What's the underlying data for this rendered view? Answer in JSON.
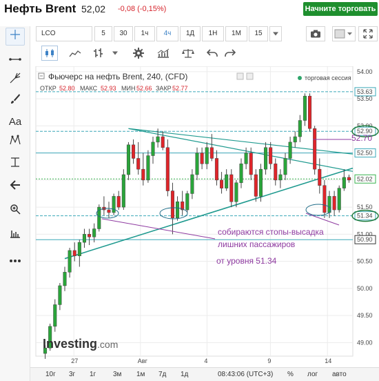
{
  "header": {
    "instrument": "Нефть Brent",
    "price": "52,02",
    "change": "-0,08 (-0,15%)",
    "trade_button": "Начните торговать"
  },
  "toolbar": {
    "symbol": "LCO",
    "intervals": [
      "5",
      "30",
      "1ч",
      "4ч",
      "1Д",
      "1Н",
      "1М",
      "15"
    ],
    "active_interval": "4ч"
  },
  "left_tools": [
    "crosshair-icon",
    "line-icon",
    "fork-icon",
    "brush-icon",
    "text-icon",
    "pattern-icon",
    "measure-icon",
    "back-arrow-icon",
    "zoom-icon",
    "ruler-icon",
    "more-icon"
  ],
  "left_text_tool": "Aa",
  "chart": {
    "title": "Фьючерс на нефть Brent, 240, (CFD)",
    "session": "торговая сессия",
    "ohlc": [
      {
        "label": "ОТКР",
        "value": "52.80"
      },
      {
        "label": "МАКС",
        "value": "52.93"
      },
      {
        "label": "МИН",
        "value": "52.66"
      },
      {
        "label": "ЗАКР",
        "value": "52.77"
      }
    ],
    "logo": "Investing",
    "logo_suffix": ".com",
    "annotation": "52.70",
    "note_lines": [
      "собираются стопы-высадка",
      "лишних пассажиров",
      "от уровня 51.34"
    ]
  },
  "chart_data": {
    "type": "candlestick",
    "title": "Фьючерс на нефть Brent, 240, (CFD)",
    "ylim": [
      48.75,
      54.1
    ],
    "y_ticks": [
      "54.00",
      "53.50",
      "53.00",
      "52.50",
      "52.00",
      "51.50",
      "51.00",
      "50.50",
      "50.00",
      "49.50",
      "49.00"
    ],
    "x_ticks": [
      "27",
      "Авг",
      "4",
      "9",
      "14"
    ],
    "price_labels": [
      "53.63",
      "52.90",
      "52.70",
      "52.50",
      "52.02",
      "51.34",
      "50.90"
    ],
    "horizontal_levels": [
      53.63,
      52.9,
      52.5,
      52.02,
      51.34,
      50.9
    ],
    "candles": [
      [
        48.8,
        48.95,
        48.7,
        48.9
      ],
      [
        48.9,
        49.35,
        48.85,
        49.3
      ],
      [
        49.3,
        49.8,
        49.2,
        49.7
      ],
      [
        49.7,
        50.1,
        49.6,
        50.05
      ],
      [
        50.05,
        50.4,
        49.95,
        50.3
      ],
      [
        50.3,
        50.75,
        50.2,
        50.7
      ],
      [
        50.7,
        50.85,
        50.5,
        50.6
      ],
      [
        50.6,
        50.9,
        50.4,
        50.85
      ],
      [
        50.85,
        51.1,
        50.75,
        51.0
      ],
      [
        51.0,
        51.1,
        50.8,
        50.95
      ],
      [
        50.95,
        51.2,
        50.85,
        51.1
      ],
      [
        51.1,
        51.55,
        51.05,
        51.5
      ],
      [
        51.5,
        51.7,
        51.35,
        51.45
      ],
      [
        51.45,
        51.6,
        51.3,
        51.4
      ],
      [
        51.4,
        51.75,
        51.35,
        51.7
      ],
      [
        51.7,
        51.8,
        51.45,
        51.5
      ],
      [
        51.5,
        52.2,
        51.45,
        52.1
      ],
      [
        52.1,
        52.7,
        52.0,
        52.65
      ],
      [
        52.65,
        52.75,
        52.3,
        52.4
      ],
      [
        52.4,
        52.7,
        52.1,
        52.2
      ],
      [
        52.2,
        52.5,
        51.9,
        52.0
      ],
      [
        52.0,
        52.55,
        51.95,
        52.45
      ],
      [
        52.45,
        52.8,
        52.3,
        52.7
      ],
      [
        52.7,
        52.95,
        52.6,
        52.8
      ],
      [
        52.8,
        52.9,
        52.55,
        52.6
      ],
      [
        52.6,
        52.75,
        51.7,
        51.8
      ],
      [
        51.8,
        51.95,
        51.0,
        51.3
      ],
      [
        51.3,
        51.7,
        51.25,
        51.6
      ],
      [
        51.6,
        51.8,
        51.35,
        51.45
      ],
      [
        51.45,
        51.8,
        51.4,
        51.75
      ],
      [
        51.75,
        52.2,
        51.65,
        52.1
      ],
      [
        52.1,
        52.6,
        52.0,
        52.5
      ],
      [
        52.5,
        52.6,
        52.2,
        52.3
      ],
      [
        52.3,
        52.7,
        52.2,
        52.6
      ],
      [
        52.6,
        52.85,
        52.35,
        52.4
      ],
      [
        52.4,
        52.55,
        51.9,
        52.0
      ],
      [
        52.0,
        52.15,
        51.75,
        51.85
      ],
      [
        51.85,
        52.2,
        51.8,
        52.1
      ],
      [
        52.1,
        52.2,
        51.5,
        51.6
      ],
      [
        51.6,
        52.0,
        51.5,
        51.95
      ],
      [
        51.95,
        52.4,
        51.85,
        52.3
      ],
      [
        52.3,
        52.6,
        52.2,
        52.5
      ],
      [
        52.5,
        52.6,
        52.0,
        52.1
      ],
      [
        52.1,
        52.2,
        51.6,
        51.7
      ],
      [
        51.7,
        52.3,
        51.6,
        52.2
      ],
      [
        52.2,
        52.7,
        52.1,
        52.6
      ],
      [
        52.6,
        52.7,
        52.2,
        52.3
      ],
      [
        52.3,
        52.4,
        51.9,
        52.0
      ],
      [
        52.0,
        52.2,
        51.85,
        52.1
      ],
      [
        52.1,
        52.5,
        52.0,
        52.4
      ],
      [
        52.4,
        52.8,
        52.3,
        52.7
      ],
      [
        52.7,
        52.9,
        52.6,
        52.8
      ],
      [
        52.8,
        53.2,
        52.7,
        53.1
      ],
      [
        53.1,
        53.6,
        53.0,
        53.55
      ],
      [
        53.55,
        53.6,
        52.9,
        52.95
      ],
      [
        52.95,
        53.0,
        52.1,
        52.2
      ],
      [
        52.2,
        52.4,
        51.75,
        51.9
      ],
      [
        51.9,
        52.0,
        51.3,
        51.4
      ],
      [
        51.4,
        51.8,
        51.3,
        51.7
      ],
      [
        51.7,
        51.8,
        51.34,
        51.45
      ],
      [
        51.45,
        51.9,
        51.4,
        51.85
      ],
      [
        51.85,
        52.2,
        51.8,
        52.05
      ],
      [
        52.05,
        52.1,
        51.95,
        52.0
      ]
    ]
  },
  "x_axis": {
    "labels": [
      "27",
      "Авг",
      "4",
      "9",
      "14"
    ]
  },
  "bottom_bar": {
    "ranges": [
      "10г",
      "3г",
      "1г",
      "3м",
      "1м",
      "7д",
      "1д"
    ],
    "time": "08:43:06 (UTC+3)",
    "percent": "%",
    "log": "лог",
    "auto": "авто"
  }
}
